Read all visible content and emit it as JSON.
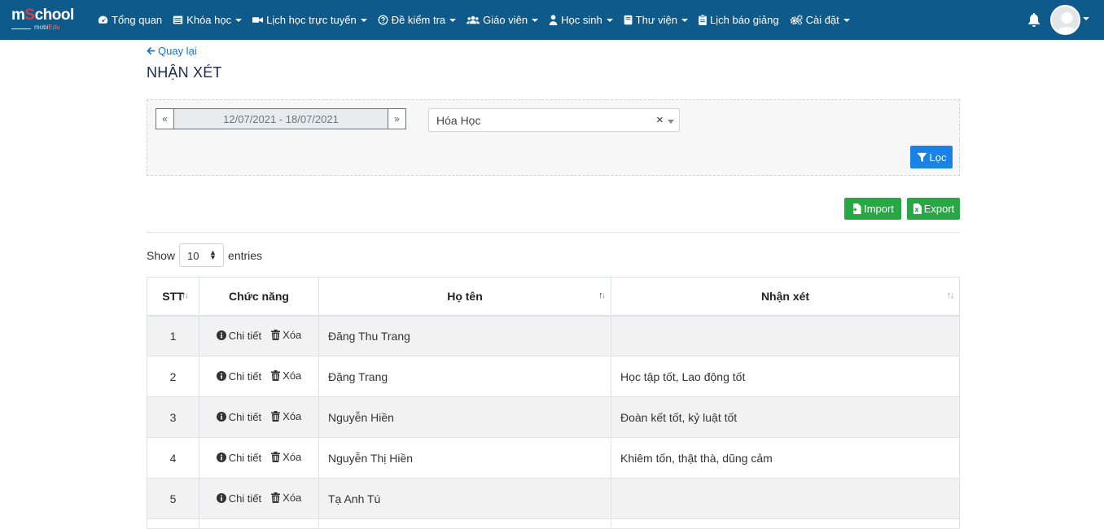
{
  "navbar": {
    "logo": {
      "main_prefix": "m",
      "main_accent": "S",
      "main_suffix": "chool",
      "sub": "mobi",
      "sub_accent": "Edu"
    },
    "items": [
      {
        "label": "Tổng quan",
        "icon": "dashboard-icon",
        "has_caret": false
      },
      {
        "label": "Khóa học",
        "icon": "course-icon",
        "has_caret": true
      },
      {
        "label": "Lịch học trực tuyến",
        "icon": "video-icon",
        "has_caret": true
      },
      {
        "label": "Đề kiểm tra",
        "icon": "question-icon",
        "has_caret": true
      },
      {
        "label": "Giáo viên",
        "icon": "users-icon",
        "has_caret": true
      },
      {
        "label": "Học sinh",
        "icon": "user-icon",
        "has_caret": true
      },
      {
        "label": "Thư viện",
        "icon": "book-icon",
        "has_caret": true
      },
      {
        "label": "Lịch báo giảng",
        "icon": "clipboard-icon",
        "has_caret": false
      },
      {
        "label": "Cài đặt",
        "icon": "cogs-icon",
        "has_caret": true
      }
    ]
  },
  "back_link": "Quay lại",
  "page_title": "NHẬN XÉT",
  "filter": {
    "prev_label": "«",
    "next_label": "»",
    "date_range": "12/07/2021 - 18/07/2021",
    "subject_value": "Hóa Học",
    "clear_label": "×",
    "filter_button": "Lọc"
  },
  "actions": {
    "import_label": "Import",
    "export_label": "Export"
  },
  "entries": {
    "show_label": "Show",
    "value": "10",
    "entries_label": "entries"
  },
  "table": {
    "headers": {
      "stt": "STT",
      "function": "Chức năng",
      "name": "Họ tên",
      "note": "Nhận xét"
    },
    "detail_label": "Chi tiết",
    "delete_label": "Xóa",
    "rows": [
      {
        "stt": "1",
        "name": "Đăng Thu Trang",
        "note": ""
      },
      {
        "stt": "2",
        "name": "Đặng Trang",
        "note": "Học tập tốt, Lao động tốt"
      },
      {
        "stt": "3",
        "name": "Nguyễn Hiền",
        "note": "Đoàn kết tốt, kỷ luật tốt"
      },
      {
        "stt": "4",
        "name": "Nguyễn Thị Hiền",
        "note": "Khiêm tốn, thật thà, dũng cảm"
      },
      {
        "stt": "5",
        "name": "Tạ Anh Tú",
        "note": ""
      }
    ]
  },
  "colors": {
    "navbar": "#0e5a8a",
    "link": "#1a73c9",
    "primary": "#1a82e6",
    "success": "#28a745",
    "striped_row": "#f2f2f2"
  }
}
